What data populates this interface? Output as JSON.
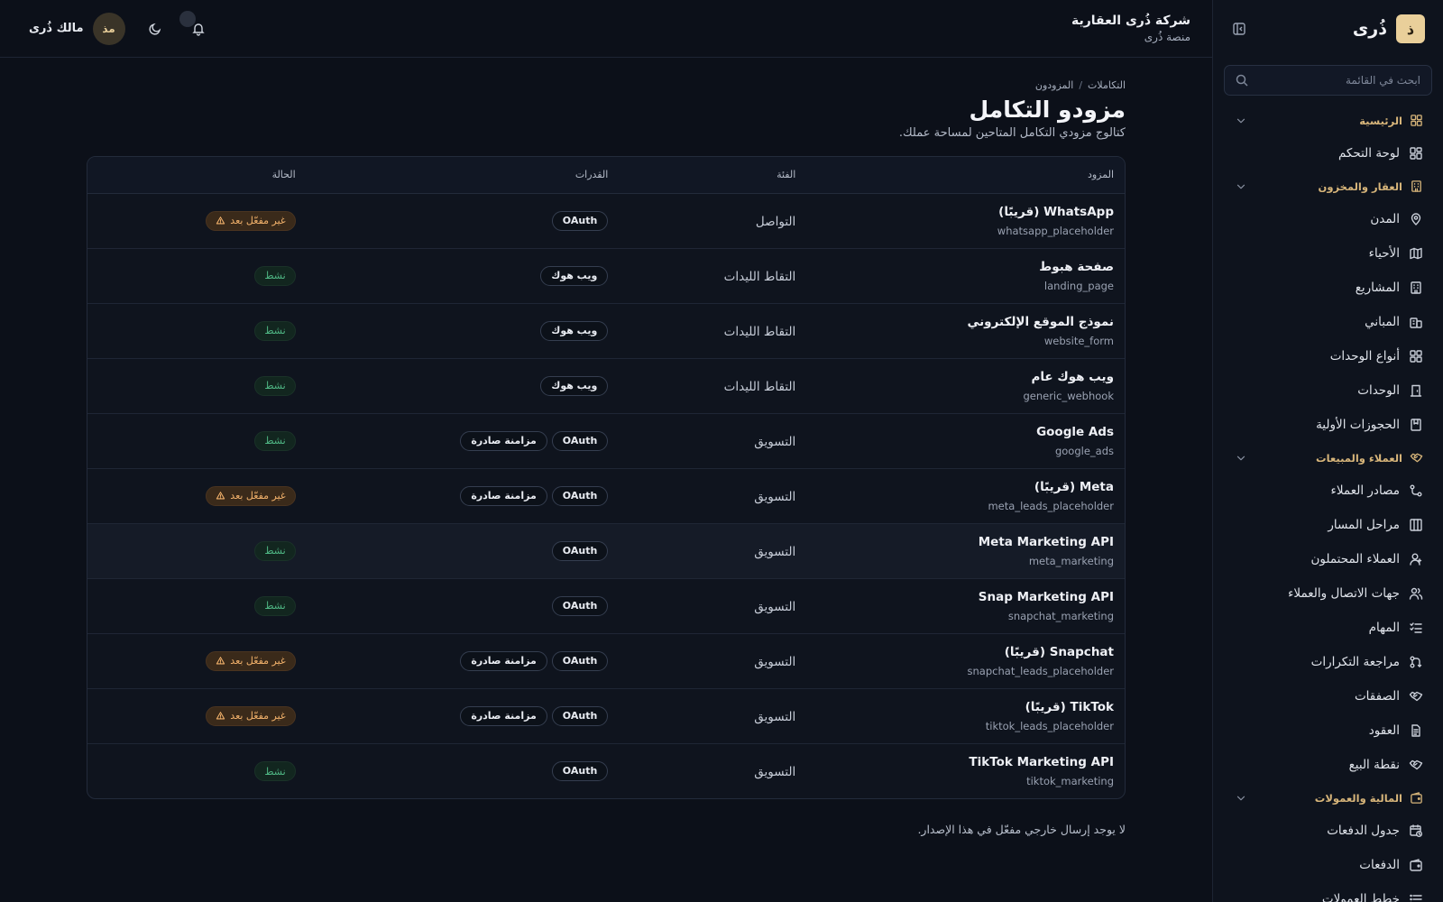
{
  "sidebar": {
    "logo_letter": "ذ",
    "logo_text": "ذُرى",
    "search_placeholder": "ابحث في القائمة",
    "groups": [
      {
        "label": "الرئيسية",
        "icon": "grid-icon",
        "items": [
          {
            "label": "لوحة التحكم",
            "icon": "dashboard-icon"
          }
        ]
      },
      {
        "label": "العقار والمخزون",
        "icon": "building-icon",
        "items": [
          {
            "label": "المدن",
            "icon": "map-pin-icon"
          },
          {
            "label": "الأحياء",
            "icon": "map-icon"
          },
          {
            "label": "المشاريع",
            "icon": "building-icon"
          },
          {
            "label": "المباني",
            "icon": "buildings-icon"
          },
          {
            "label": "أنواع الوحدات",
            "icon": "grid-icon"
          },
          {
            "label": "الوحدات",
            "icon": "door-icon"
          },
          {
            "label": "الحجوزات الأولية",
            "icon": "bookmark-icon"
          }
        ]
      },
      {
        "label": "العملاء والمبيعات",
        "icon": "handshake-icon",
        "items": [
          {
            "label": "مصادر العملاء",
            "icon": "branch-icon"
          },
          {
            "label": "مراحل المسار",
            "icon": "columns-icon"
          },
          {
            "label": "العملاء المحتملون",
            "icon": "user-icon"
          },
          {
            "label": "جهات الاتصال والعملاء",
            "icon": "users-icon"
          },
          {
            "label": "المهام",
            "icon": "checklist-icon"
          },
          {
            "label": "مراجعة التكرارات",
            "icon": "merge-icon"
          },
          {
            "label": "الصفقات",
            "icon": "handshake-icon"
          },
          {
            "label": "العقود",
            "icon": "document-icon"
          },
          {
            "label": "نقطة البيع",
            "icon": "handshake-icon"
          }
        ]
      },
      {
        "label": "المالية والعمولات",
        "icon": "wallet-icon",
        "items": [
          {
            "label": "جدول الدفعات",
            "icon": "calendar-clock-icon"
          },
          {
            "label": "الدفعات",
            "icon": "wallet-icon"
          },
          {
            "label": "خطط العمولات",
            "icon": "list-icon"
          }
        ]
      }
    ]
  },
  "topbar": {
    "org_name": "شركة ذُرى العقارية",
    "org_sub": "منصة ذُرى",
    "user_initials": "مذ",
    "user_name": "مالك ذُرى"
  },
  "page": {
    "breadcrumb": [
      "التكاملات",
      "المزودون"
    ],
    "breadcrumb_sep": "/",
    "title": "مزودو التكامل",
    "description": "كتالوج مزودي التكامل المتاحين لمساحة عملك.",
    "footnote": "لا يوجد إرسال خارجي مفعّل في هذا الإصدار."
  },
  "table": {
    "headers": {
      "provider": "المزود",
      "category": "الفئة",
      "capabilities": "القدرات",
      "status": "الحالة"
    },
    "rows": [
      {
        "name": "WhatsApp (قريبًا)",
        "key": "whatsapp_placeholder",
        "category": "التواصل",
        "caps": [
          "OAuth"
        ],
        "status": "غير مفعّل بعد",
        "status_type": "inactive"
      },
      {
        "name": "صفحة هبوط",
        "key": "landing_page",
        "category": "التقاط الليدات",
        "caps": [
          "ويب هوك"
        ],
        "status": "نشط",
        "status_type": "active"
      },
      {
        "name": "نموذج الموقع الإلكتروني",
        "key": "website_form",
        "category": "التقاط الليدات",
        "caps": [
          "ويب هوك"
        ],
        "status": "نشط",
        "status_type": "active"
      },
      {
        "name": "ويب هوك عام",
        "key": "generic_webhook",
        "category": "التقاط الليدات",
        "caps": [
          "ويب هوك"
        ],
        "status": "نشط",
        "status_type": "active"
      },
      {
        "name": "Google Ads",
        "key": "google_ads",
        "category": "التسويق",
        "caps": [
          "OAuth",
          "مزامنة صادرة"
        ],
        "status": "نشط",
        "status_type": "active"
      },
      {
        "name": "Meta (قريبًا)",
        "key": "meta_leads_placeholder",
        "category": "التسويق",
        "caps": [
          "OAuth",
          "مزامنة صادرة"
        ],
        "status": "غير مفعّل بعد",
        "status_type": "inactive"
      },
      {
        "name": "Meta Marketing API",
        "key": "meta_marketing",
        "category": "التسويق",
        "caps": [
          "OAuth"
        ],
        "status": "نشط",
        "status_type": "active"
      },
      {
        "name": "Snap Marketing API",
        "key": "snapchat_marketing",
        "category": "التسويق",
        "caps": [
          "OAuth"
        ],
        "status": "نشط",
        "status_type": "active"
      },
      {
        "name": "Snapchat (قريبًا)",
        "key": "snapchat_leads_placeholder",
        "category": "التسويق",
        "caps": [
          "OAuth",
          "مزامنة صادرة"
        ],
        "status": "غير مفعّل بعد",
        "status_type": "inactive"
      },
      {
        "name": "TikTok (قريبًا)",
        "key": "tiktok_leads_placeholder",
        "category": "التسويق",
        "caps": [
          "OAuth",
          "مزامنة صادرة"
        ],
        "status": "غير مفعّل بعد",
        "status_type": "inactive"
      },
      {
        "name": "TikTok Marketing API",
        "key": "tiktok_marketing",
        "category": "التسويق",
        "caps": [
          "OAuth"
        ],
        "status": "نشط",
        "status_type": "active"
      }
    ]
  },
  "colors": {
    "accent": "#d7b57a",
    "background": "#0c1019",
    "warning": "#f0b06a",
    "success": "#4fb784"
  }
}
